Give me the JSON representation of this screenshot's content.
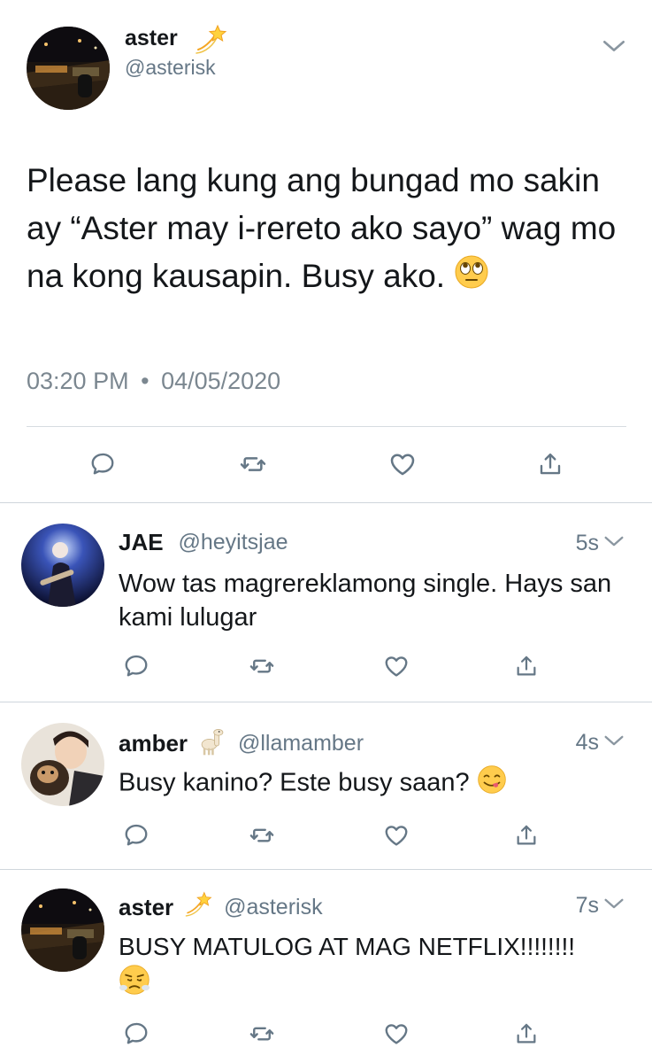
{
  "main_tweet": {
    "name": "aster",
    "handle": "@asterisk",
    "name_emoji_icon": "dizzy-icon",
    "text": "Please lang kung ang bungad mo sakin ay “Aster may i-rereto ako sayo” wag mo na kong kausapin. Busy ako.",
    "text_emoji_icon": "rolling-eyes-emoji",
    "time": "03:20 PM",
    "separator": "•",
    "date": "04/05/2020"
  },
  "replies": [
    {
      "name": "JAE",
      "handle": "@heyitsjae",
      "time": "5s",
      "text": "Wow tas magrereklamong single. Hays san kami lulugar"
    },
    {
      "name": "amber",
      "name_emoji_icon": "llama-icon",
      "handle": "@llamamber",
      "time": "4s",
      "text": "Busy kanino? Este busy saan?",
      "text_emoji_icon": "yum-emoji"
    },
    {
      "name": "aster",
      "name_emoji_icon": "dizzy-icon",
      "handle": "@asterisk",
      "time": "7s",
      "text": "BUSY MATULOG AT MAG NETFLIX!!!!!!!!",
      "text_emoji_icon": "triumph-emoji"
    }
  ],
  "icons": {
    "reply": "reply-icon",
    "retweet": "retweet-icon",
    "like": "heart-icon",
    "share": "share-icon",
    "menu": "chevron-down-icon"
  },
  "colors": {
    "text": "#14171a",
    "secondary": "#657786",
    "divider": "#cfd6dc",
    "action_icon": "#657786"
  }
}
